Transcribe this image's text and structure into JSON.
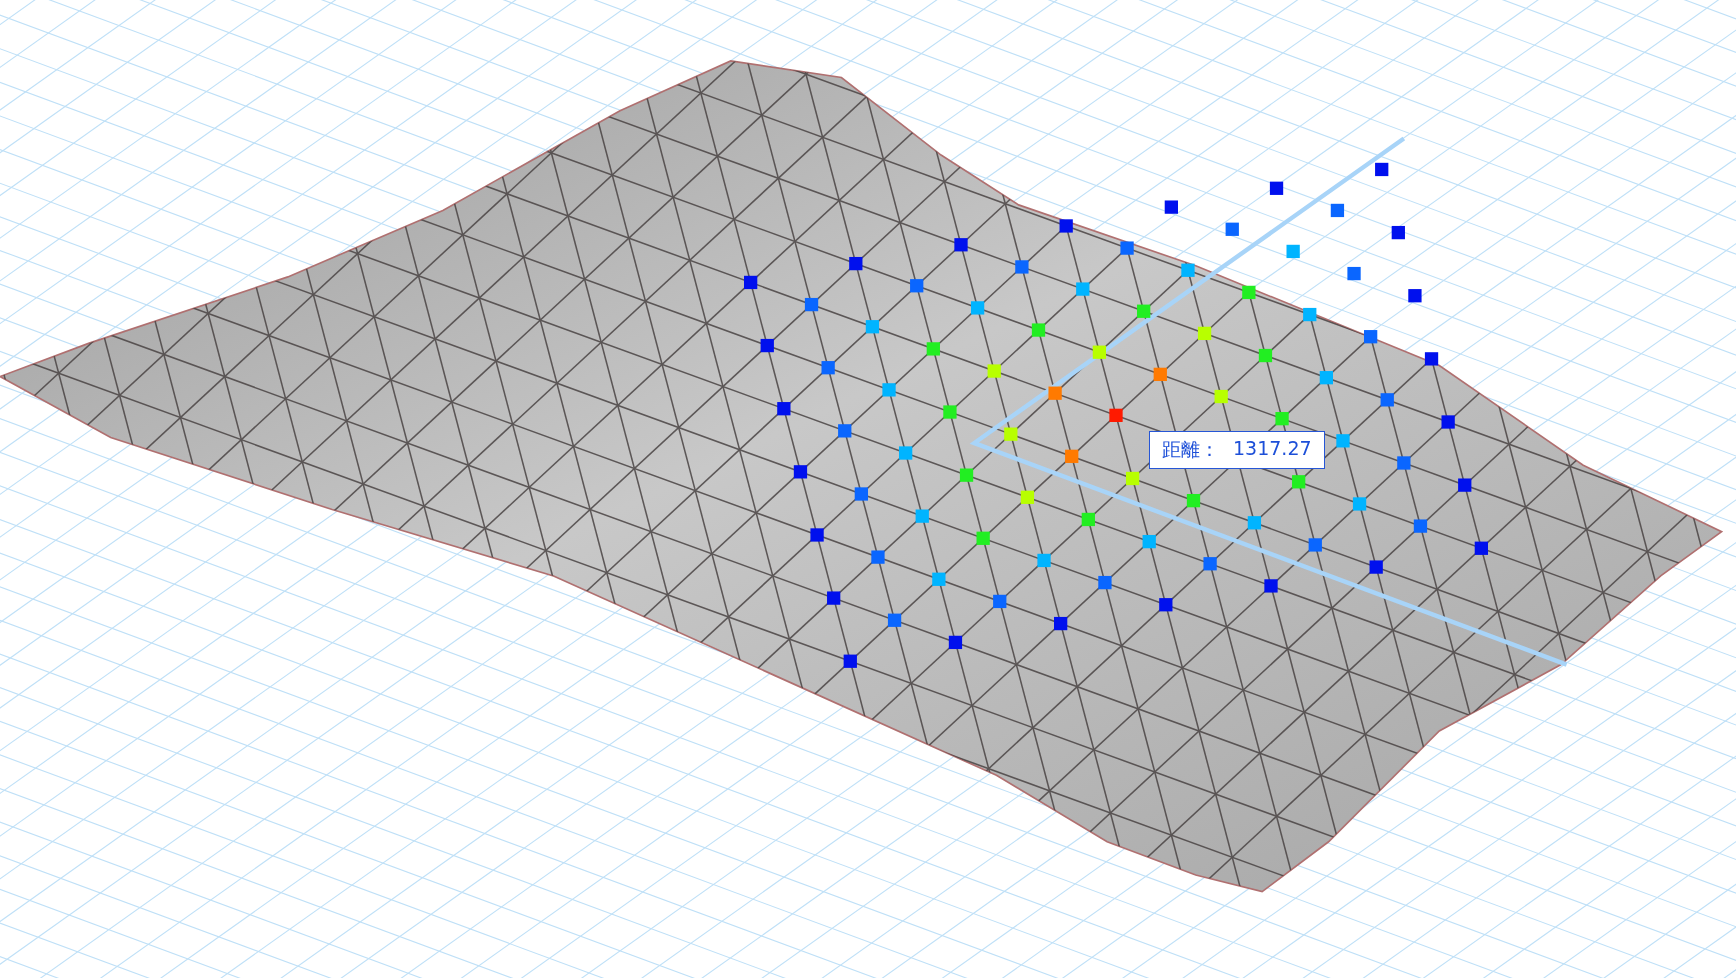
{
  "measurement": {
    "label": "距離：",
    "value": "1317.27"
  }
}
